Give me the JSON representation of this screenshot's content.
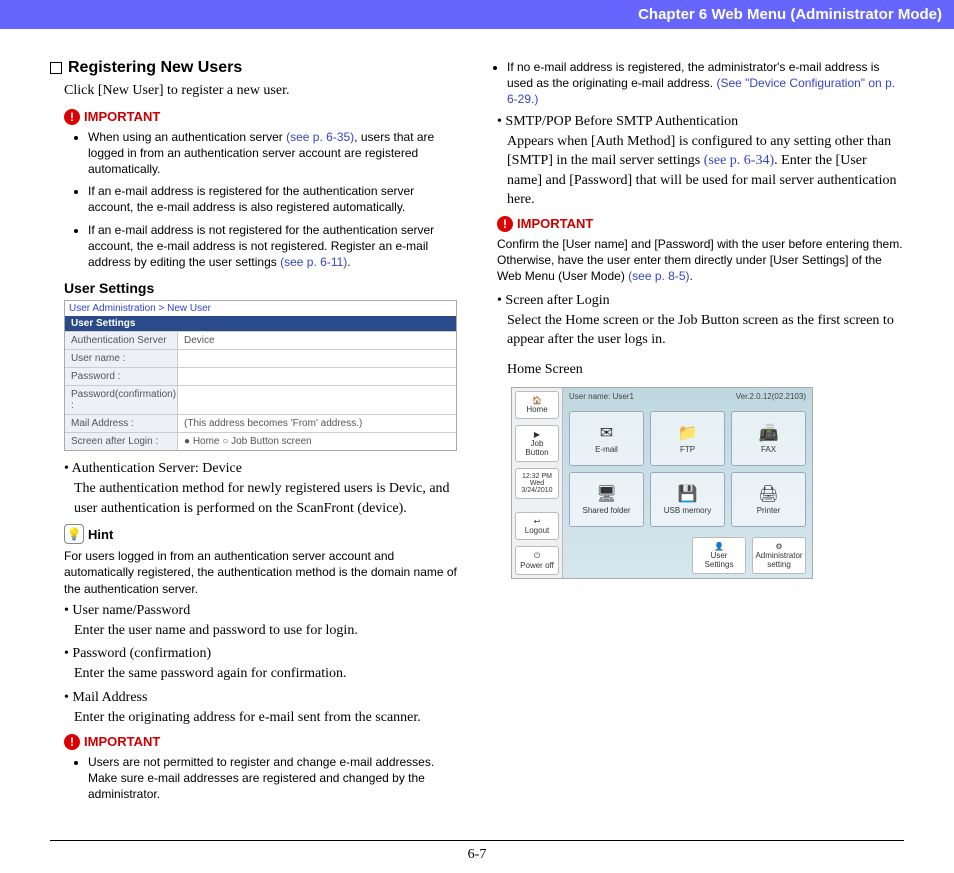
{
  "header": "Chapter 6   Web Menu (Administrator Mode)",
  "left": {
    "title": "Registering New Users",
    "intro": "Click [New User] to register a new user.",
    "important1": {
      "label": "IMPORTANT",
      "items": [
        {
          "pre": "When using an authentication server ",
          "link": "(see p. 6-35)",
          "post": ", users that are logged in from an authentication server account are registered automatically."
        },
        {
          "pre": "If an e-mail address is registered for the authentication server account, the e-mail address is also registered automatically.",
          "link": "",
          "post": ""
        },
        {
          "pre": "If an e-mail address is not registered for the authentication server account, the e-mail address is not registered. Register an e-mail address by editing the user settings ",
          "link": "(see p. 6-11)",
          "post": "."
        }
      ]
    },
    "userSettingsHeading": "User Settings",
    "usTable": {
      "title": "User Administration > New User",
      "header": "User Settings",
      "rows": [
        {
          "label": "Authentication Server",
          "val": "Device"
        },
        {
          "label": "User name :",
          "val": ""
        },
        {
          "label": "Password :",
          "val": ""
        },
        {
          "label": "Password(confirmation) :",
          "val": ""
        },
        {
          "label": "Mail Address :",
          "val": "(This address becomes 'From' address.)"
        },
        {
          "label": "Screen after Login :",
          "val": "● Home   ○ Job Button screen"
        }
      ]
    },
    "bullets": [
      {
        "t": "Authentication Server: Device",
        "d": "The authentication method for newly registered users is Devic, and user authentication is performed on the ScanFront (device)."
      }
    ],
    "hint": {
      "label": "Hint",
      "text": "For users logged in from an authentication server account and automatically registered, the authentication method is the domain name of the authentication server."
    },
    "bullets2": [
      {
        "t": "User name/Password",
        "d": "Enter the user name and password to use for login."
      },
      {
        "t": "Password (confirmation)",
        "d": "Enter the same password again for confirmation."
      },
      {
        "t": "Mail Address",
        "d": "Enter the originating address for e-mail sent from the scanner."
      }
    ],
    "important2": {
      "label": "IMPORTANT",
      "items": [
        "Users are not permitted to register and change e-mail addresses. Make sure e-mail addresses are registered and changed by the administrator."
      ]
    }
  },
  "right": {
    "topBullet": {
      "pre": "If no e-mail address is registered, the administrator's e-mail address is used as the originating e-mail address. ",
      "link": "(See \"Device Configuration\" on p. 6-29.)"
    },
    "smtp": {
      "t": "SMTP/POP Before SMTP Authentication",
      "d1_pre": "Appears when [Auth Method] is configured to any setting other than [SMTP] in the mail server settings ",
      "d1_link": "(see p. 6-34)",
      "d1_post": ". Enter the [User name] and [Password] that will be used for mail server authentication here."
    },
    "important": {
      "label": "IMPORTANT",
      "text_pre": "Confirm the [User name] and [Password] with the user before entering them. Otherwise, have the user enter them directly under [User Settings] of the Web Menu (User Mode) ",
      "text_link": "(see p. 8-5)",
      "text_post": "."
    },
    "screen": {
      "t": "Screen after Login",
      "d": "Select the Home screen or the Job Button screen as the first screen to appear after the user logs in."
    },
    "homeLabel": "Home Screen",
    "hs": {
      "user": "User name: User1",
      "ver": "Ver.2.0.12(02.2103)",
      "side": [
        "Home",
        "Job Button",
        "12:32 PM Wed 3/24/2010",
        "Logout",
        "Power off"
      ],
      "tiles": [
        "E-mail",
        "FTP",
        "FAX",
        "Shared folder",
        "USB memory",
        "Printer"
      ],
      "bottom": [
        "User Settings",
        "Administrator setting"
      ]
    }
  },
  "pageNum": "6-7"
}
